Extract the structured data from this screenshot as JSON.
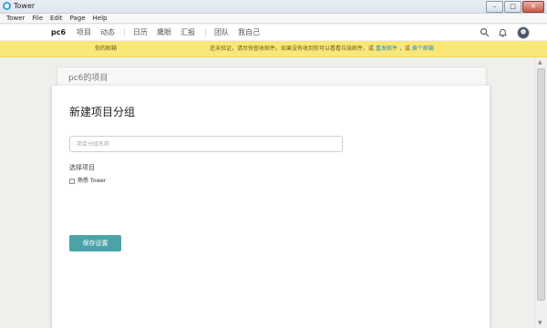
{
  "window": {
    "title": "Tower",
    "minimize": "–",
    "maximize": "□",
    "close": "✕"
  },
  "menu": [
    "Tower",
    "File",
    "Edit",
    "Page",
    "Help"
  ],
  "nav": {
    "brand": "pc6",
    "items": [
      "项目",
      "动态",
      "日历",
      "鹰眼",
      "汇报",
      "团队",
      "我自己"
    ],
    "icons": [
      "search-icon",
      "bell-icon",
      "avatar"
    ]
  },
  "notice": {
    "left": "你的邮箱",
    "text": "还未验证，请尽快查收邮件。如果没有收到你可以看看垃圾邮件，或",
    "link1": "重发邮件",
    "sep": "，或",
    "link2": "换个邮箱",
    "color": "#fae77a"
  },
  "background_card": {
    "title": "pc6的项目"
  },
  "form": {
    "title": "新建项目分组",
    "group_name_placeholder": "项目分组名称",
    "group_name_value": "",
    "select_label": "选择项目",
    "projects": [
      {
        "label": "熟悉 Tower",
        "checked": false
      }
    ],
    "save_label": "保存设置",
    "save_color": "#4aa3a8"
  }
}
